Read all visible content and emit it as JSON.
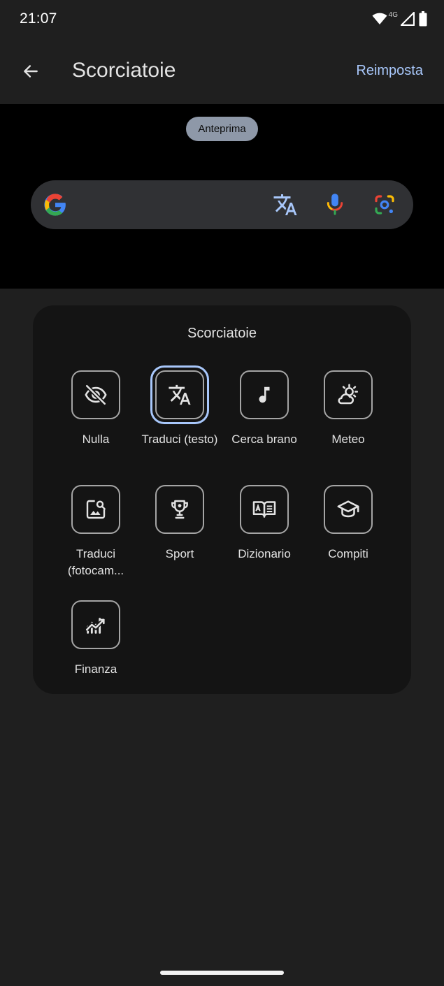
{
  "status_bar": {
    "time": "21:07",
    "network": "4G"
  },
  "app_bar": {
    "title": "Scorciatoie",
    "reset_label": "Reimposta"
  },
  "preview": {
    "chip_label": "Anteprima"
  },
  "panel": {
    "title": "Scorciatoie",
    "items": [
      {
        "label": "Nulla",
        "icon": "eye-off-icon",
        "selected": false
      },
      {
        "label": "Traduci (testo)",
        "icon": "translate-icon",
        "selected": true
      },
      {
        "label": "Cerca brano",
        "icon": "music-note-icon",
        "selected": false
      },
      {
        "label": "Meteo",
        "icon": "weather-partly-cloudy-icon",
        "selected": false
      },
      {
        "label": "Traduci (fotocam...",
        "icon": "image-search-icon",
        "selected": false
      },
      {
        "label": "Sport",
        "icon": "trophy-icon",
        "selected": false
      },
      {
        "label": "Dizionario",
        "icon": "dictionary-book-icon",
        "selected": false
      },
      {
        "label": "Compiti",
        "icon": "school-cap-icon",
        "selected": false
      },
      {
        "label": "Finanza",
        "icon": "finance-chart-icon",
        "selected": false
      }
    ]
  },
  "colors": {
    "accent": "#a8c7fa",
    "background": "#1f1f1f",
    "panel": "#141414",
    "preview": "#000000"
  }
}
